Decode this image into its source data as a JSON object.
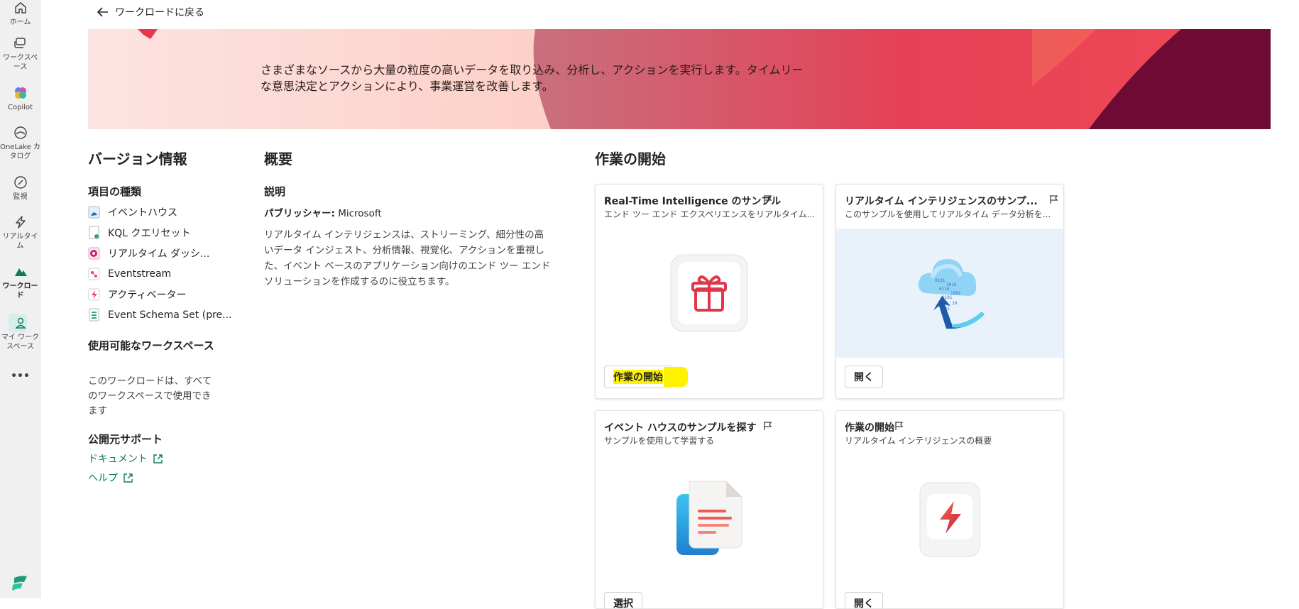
{
  "rail": {
    "items": [
      {
        "label": "ホーム",
        "icon": "home-icon"
      },
      {
        "label": "ワークスペース",
        "icon": "workspaces-icon"
      },
      {
        "label": "Copilot",
        "icon": "copilot-icon"
      },
      {
        "label": "OneLake カタログ",
        "icon": "onelake-icon"
      },
      {
        "label": "監視",
        "icon": "monitor-icon"
      },
      {
        "label": "リアルタイム",
        "icon": "realtime-icon"
      },
      {
        "label": "ワークロード",
        "icon": "workload-icon"
      },
      {
        "label": "マイ ワークスペース",
        "icon": "my-workspace-icon"
      }
    ],
    "more": "•••",
    "fabric_label": "Fabric"
  },
  "nav": {
    "back_label": "ワークロードに戻る"
  },
  "banner": {
    "description": "さまざまなソースから大量の粒度の高いデータを取り込み、分析し、アクションを実行します。タイムリーな意思決定とアクションにより、事業運営を改善します。"
  },
  "version": {
    "heading": "バージョン情報",
    "item_types_heading": "項目の種類",
    "item_types": [
      {
        "label": "イベントハウス",
        "icon": "eventhouse-icon"
      },
      {
        "label": "KQL クエリセット",
        "icon": "kql-queryset-icon"
      },
      {
        "label": "リアルタイム ダッシ...",
        "icon": "realtime-dashboard-icon"
      },
      {
        "label": "Eventstream",
        "icon": "eventstream-icon"
      },
      {
        "label": "アクティベーター",
        "icon": "activator-icon"
      },
      {
        "label": "Event Schema Set (pre...",
        "icon": "event-schema-set-icon"
      }
    ],
    "workspaces_heading": "使用可能なワークスペース",
    "workspaces_text": "このワークロードは、すべてのワークスペースで使用できます",
    "support_heading": "公開元サポート",
    "links": [
      "ドキュメント",
      "ヘルプ"
    ]
  },
  "overview": {
    "heading": "概要",
    "desc_heading": "説明",
    "publisher_label": "パブリッシャー:",
    "publisher_value": "Microsoft",
    "description": "リアルタイム インテリジェンスは、ストリーミング、細分性の高いデータ インジェスト、分析情報、視覚化、アクションを重視した、イベント ベースのアプリケーション向けのエンド ツー エンド ソリューションを作成するのに役立ちます。"
  },
  "start": {
    "heading": "作業の開始",
    "cards": [
      {
        "title": "Real-Time Intelligence のサンプル",
        "subtitle": "エンド ツー エンド エクスペリエンスをリアルタイム...",
        "button": "作業の開始",
        "image": "gift-icon"
      },
      {
        "title": "リアルタイム インテリジェンスのサンプ...",
        "subtitle": "このサンプルを使用してリアルタイム データ分析を...",
        "button": "開く",
        "image": "cloud-upload-illustration"
      },
      {
        "title": "イベント ハウスのサンプルを探す",
        "subtitle": "サンプルを使用して学習する",
        "button": "選択",
        "image": "document-icon"
      },
      {
        "title": "作業の開始",
        "subtitle": "リアルタイム インテリジェンスの概要",
        "button": "開く",
        "image": "lightning-icon"
      }
    ]
  },
  "colors": {
    "accent": "#0e7a5c",
    "highlight": "#fff200",
    "banner_red": "#e8364c"
  }
}
